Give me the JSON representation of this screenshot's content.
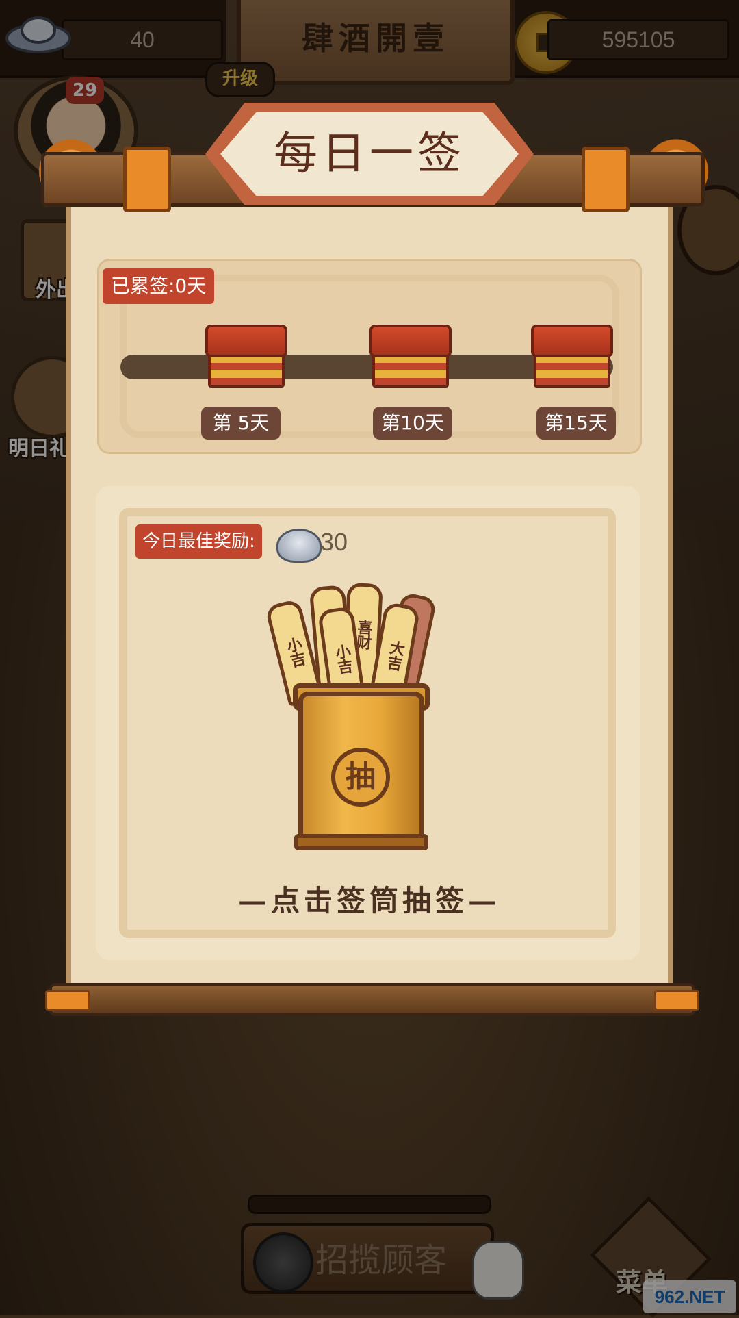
{
  "hud": {
    "silver": "40",
    "coins": "595105",
    "shop_name": "肆酒開壹",
    "upgrade": "升级",
    "level": "29",
    "side_left_1": "外出",
    "side_left_2": "明日礼",
    "recruit": "招揽顾客",
    "menu": "菜单",
    "watermark": "962.NET"
  },
  "dialog": {
    "title": "每日一签",
    "streak": "已累签:0天",
    "milestones": [
      "第 5天",
      "第10天",
      "第15天"
    ],
    "best_reward_label": "今日最佳奖励:",
    "best_reward_amount": "30",
    "hint": "—点击签筒抽签—",
    "cup_seal": "抽",
    "sticks": [
      "小吉",
      "大吉",
      "喜财",
      "小吉",
      "大吉"
    ]
  },
  "colors": {
    "accent_red": "#c0452c",
    "milestone_bg": "#6e4637",
    "scroll_paper": "#ecdcbc",
    "rod_orange": "#e88b28"
  }
}
